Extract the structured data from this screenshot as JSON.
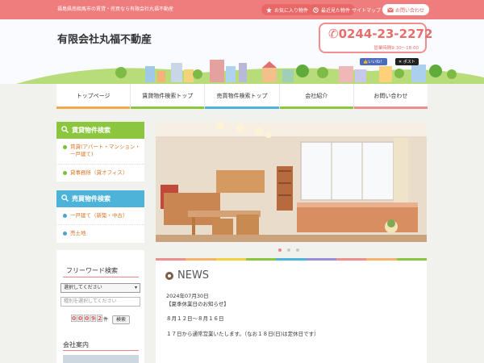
{
  "topbar": {
    "tagline": "福島県南相馬市の賃貸・売買なら有限会社丸福不動産",
    "favorites_label": "お気に入り物件",
    "recent_label": "最近見た物件",
    "sitemap_label": "サイトマップ",
    "contact_label": "お問い合わせ"
  },
  "header": {
    "company_name": "有限会社丸福不動産",
    "phone": "0244-23-2272",
    "hours": "営業時間9:30～18:00",
    "fb_label": "いいね！",
    "tw_label": "ポスト"
  },
  "nav": {
    "items": [
      {
        "label": "トップページ",
        "color": "#f0a84a"
      },
      {
        "label": "賃貸物件検索トップ",
        "color": "#8cc63f"
      },
      {
        "label": "売買物件検索トップ",
        "color": "#4eb3d9"
      },
      {
        "label": "会社紹介",
        "color": "#8cc63f"
      },
      {
        "label": "お問い合わせ",
        "color": "#f08e8e"
      }
    ]
  },
  "sidebar": {
    "rent": {
      "title": "賃貸物件検索",
      "color": "#8cc63f",
      "links": [
        "賃貸(アパート・マンション・一戸建て)",
        "貸事務所（貸オフィス）"
      ]
    },
    "sale": {
      "title": "売買物件検索",
      "color": "#4eb3d9",
      "links": [
        "一戸建て（新築・中古）",
        "売土地"
      ]
    },
    "keyword": {
      "title": "フリーワード検索",
      "select_value": "選択してください",
      "input_placeholder": "種別を選択してください",
      "counter_digits": [
        "0",
        "0",
        "0",
        "9",
        "2"
      ],
      "counter_unit": "件",
      "search_button": "検索"
    },
    "company_info_title": "会社案内"
  },
  "news": {
    "title": "NEWS",
    "date": "2024年07月30日",
    "headline": "【夏季休業日のお知らせ】",
    "line1": "８月１２日～８月１６日",
    "line2": "１７日から通常営業いたします。（なお１８日(日)は定休日です）"
  },
  "colors": {
    "accent": "#f07d7d",
    "rent": "#8cc63f",
    "sale": "#4eb3d9"
  }
}
